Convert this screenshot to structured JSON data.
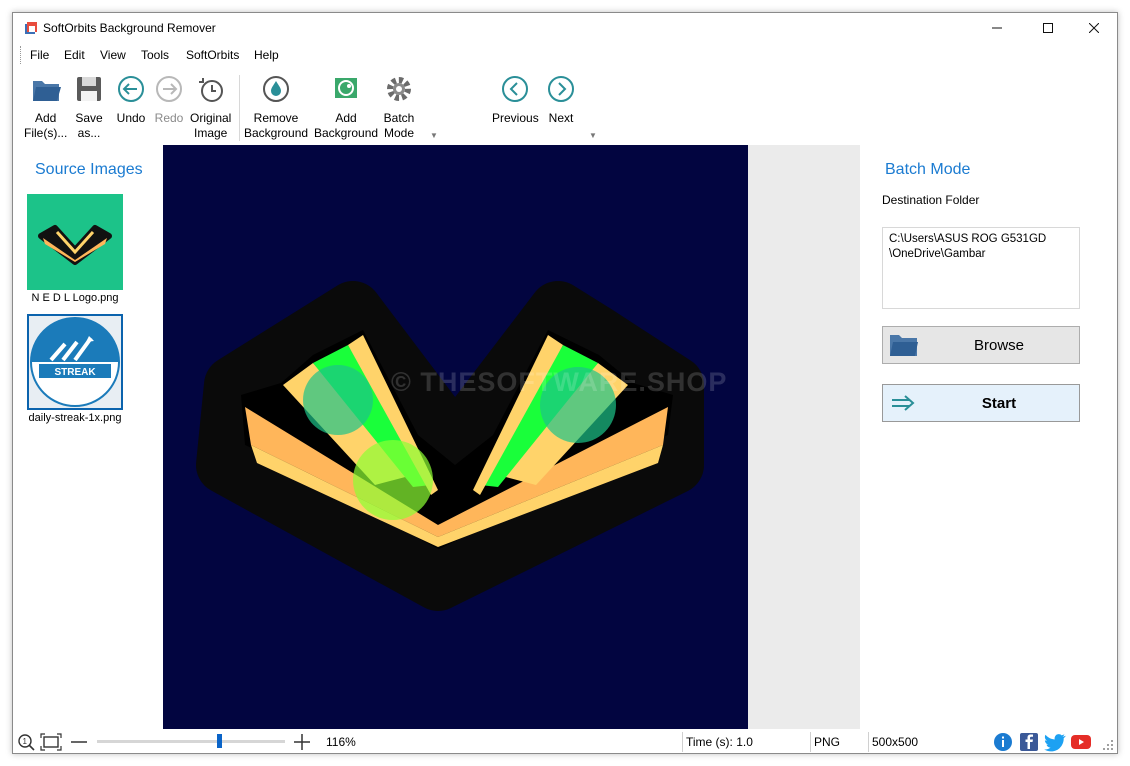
{
  "window": {
    "title": "SoftOrbits Background Remover"
  },
  "menu": [
    "File",
    "Edit",
    "View",
    "Tools",
    "SoftOrbits",
    "Help"
  ],
  "toolbar": {
    "add_files": "Add\nFile(s)...",
    "save_as": "Save\nas...",
    "undo": "Undo",
    "redo": "Redo",
    "original_image": "Original\nImage",
    "remove_background": "Remove\nBackground",
    "add_background": "Add\nBackground",
    "batch_mode": "Batch\nMode",
    "previous": "Previous",
    "next": "Next"
  },
  "source_panel": {
    "title": "Source Images",
    "images": [
      {
        "name": "N E D L Logo.png"
      },
      {
        "name": "daily-streak-1x.png",
        "badge_text": "STREAK"
      }
    ]
  },
  "canvas": {
    "watermark": "© THESOFTWARE.SHOP"
  },
  "batch_panel": {
    "title": "Batch Mode",
    "destination_label": "Destination Folder",
    "destination_path": "C:\\Users\\ASUS ROG G531GD\n\\OneDrive\\Gambar",
    "browse_label": "Browse",
    "start_label": "Start"
  },
  "status": {
    "zoom_level": "116%",
    "zoom_slider_fraction": 0.65,
    "time": "Time (s): 1.0",
    "format": "PNG",
    "dimensions": "500x500"
  },
  "colors": {
    "accent": "#1b7bd1",
    "canvas_background": "#020540",
    "thumb_green": "#1cc389",
    "logo_green": "#19ff3a",
    "logo_orange": "#ffb65a",
    "logo_yellow": "#ffd36a"
  }
}
